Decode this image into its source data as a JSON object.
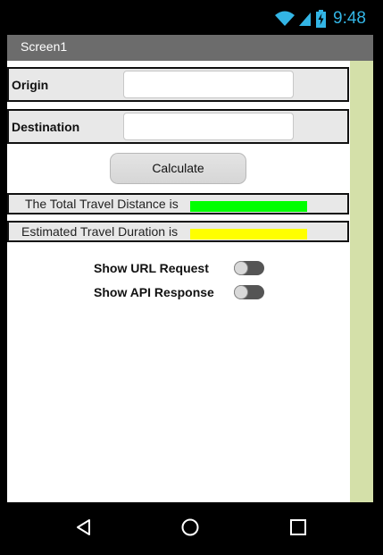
{
  "status_bar": {
    "time": "9:48",
    "icons": [
      "wifi-icon",
      "signal-icon",
      "battery-charging-icon"
    ],
    "accent_color": "#33b5e5"
  },
  "title_bar": {
    "title": "Screen1"
  },
  "form": {
    "origin_label": "Origin",
    "origin_value": "",
    "destination_label": "Destination",
    "destination_value": "",
    "calculate_label": "Calculate"
  },
  "results": {
    "distance_label": "The Total Travel Distance is",
    "distance_value": "",
    "distance_color": "#00ff00",
    "duration_label": "Estimated Travel Duration is",
    "duration_value": "",
    "duration_color": "#ffff00"
  },
  "switches": {
    "url_request_label": "Show URL Request",
    "url_request_on": false,
    "api_response_label": "Show API Response",
    "api_response_on": false
  },
  "nav_bar": {
    "icons": [
      "back-icon",
      "home-icon",
      "recents-icon"
    ]
  },
  "colors": {
    "title_bar": "#6c6c6c",
    "right_strip": "#d4e0a9"
  }
}
